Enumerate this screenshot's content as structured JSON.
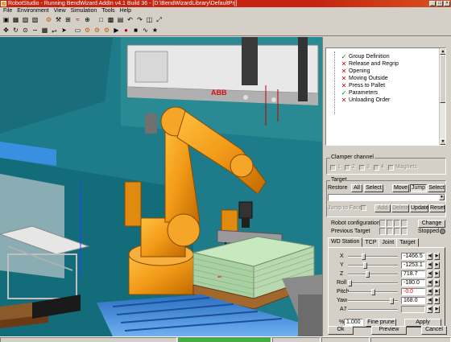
{
  "window": {
    "title": "RobotStudio - Running BendWizard AddIn v4.1 Build 36 - [D:\\BendWizardLibrary\\DefaultPrj]",
    "controls": [
      "_",
      "□",
      "×"
    ]
  },
  "menu": [
    "File",
    "Environment",
    "View",
    "Simulation",
    "Tools",
    "Help"
  ],
  "toolbar1_icons": [
    "open-icon",
    "save-icon",
    "cut-icon",
    "copy-icon",
    "robot-icon",
    "tool-icon",
    "frame-icon",
    "path-icon",
    "target-icon",
    "new-icon",
    "save-project-icon",
    "print-icon",
    "undo-icon",
    "redo-icon",
    "view-icon",
    "snap-icon"
  ],
  "toolbar2_icons": [
    "move-icon",
    "rotate-icon",
    "joint-icon",
    "link-icon",
    "grid-icon",
    "axis-icon",
    "arrow-icon",
    "box-icon",
    "joint-move-icon",
    "linear-move-icon",
    "reorient-icon",
    "play-icon",
    "record-icon",
    "stop-icon",
    "trace-icon",
    "zoom-icon"
  ],
  "viewport": {
    "logo_text": "ABB",
    "colors": {
      "background": "#1e7c8a",
      "robot": "#f29a18",
      "conveyor": "#4a8fd8",
      "pallet": "#8a5a2a"
    }
  },
  "tree": {
    "items": [
      {
        "label": "Group Definition",
        "status": "check"
      },
      {
        "label": "Release and Regrip",
        "status": "x"
      },
      {
        "label": "Opening",
        "status": "x"
      },
      {
        "label": "Moving Outside",
        "status": "x"
      },
      {
        "label": "Press to Pallet",
        "status": "x"
      },
      {
        "label": "Parameters",
        "status": "check"
      },
      {
        "label": "Unloading Order",
        "status": "x"
      }
    ]
  },
  "clamper": {
    "title": "Clamper channel",
    "channels": [
      "1",
      "2",
      "3",
      "4"
    ],
    "magnets_label": "Magnets"
  },
  "target": {
    "title": "Target",
    "restore_label": "Restore",
    "all_label": "All",
    "select_label": "Select",
    "move_label": "Move",
    "jump_label": "Jump",
    "select2_label": "Select",
    "jump_to_face_label": "Jump to Face",
    "add_label": "Add",
    "delete_label": "Delete",
    "update_label": "Update",
    "reset_label": "Reset",
    "combo_value": ""
  },
  "robot_config": {
    "label": "Robot configuration:",
    "previous_label": "Previous Target",
    "change_label": "Change",
    "stopped_label": "Stopped"
  },
  "tabs": [
    "WD Station",
    "TCP",
    "Joint",
    "Target"
  ],
  "station": {
    "rows": [
      {
        "label": "X",
        "value": "-1466.5",
        "red": false,
        "level": 0.3
      },
      {
        "label": "Y",
        "value": "-1253.1",
        "red": false,
        "level": 0.34
      },
      {
        "label": "Z",
        "value": "718.7",
        "red": false,
        "level": 0.38
      },
      {
        "label": "Roll",
        "value": "-180.0",
        "red": false,
        "level": 0.0
      },
      {
        "label": "Pitch",
        "value": "-0.0",
        "red": true,
        "level": 0.5
      },
      {
        "label": "Yaw",
        "value": "168.0",
        "red": false,
        "level": 0.92
      },
      {
        "label": "A7",
        "value": "",
        "red": false,
        "level": 0.0
      }
    ],
    "step_prefix": "%",
    "step_value": "1.000",
    "fine_prune_label": "Fine prune",
    "apply_label": "Apply"
  },
  "bottom_buttons": {
    "ok_label": "Ok",
    "preview_label": "Preview",
    "cancel_label": "Cancel"
  }
}
